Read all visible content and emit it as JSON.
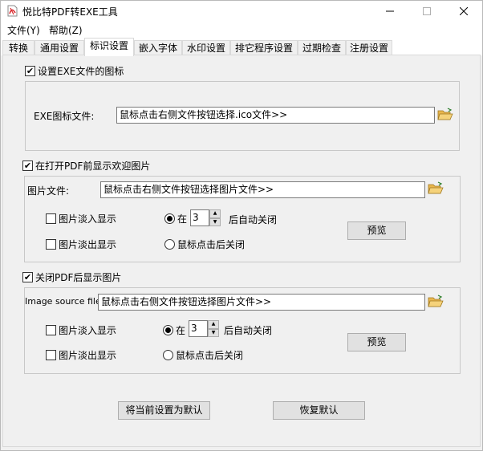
{
  "window": {
    "title": "悦比特PDF转EXE工具"
  },
  "menu": {
    "file": "文件(Y)",
    "help": "帮助(Z)"
  },
  "tabs": [
    {
      "label": "转换"
    },
    {
      "label": "通用设置"
    },
    {
      "label": "标识设置"
    },
    {
      "label": "嵌入字体"
    },
    {
      "label": "水印设置"
    },
    {
      "label": "排它程序设置"
    },
    {
      "label": "过期检查"
    },
    {
      "label": "注册设置"
    }
  ],
  "section_icon": {
    "checkbox_label": "设置EXE文件的图标",
    "checked": true,
    "field_label": "EXE图标文件:",
    "field_value": "鼠标点击右侧文件按钮选择.ico文件>>"
  },
  "section_welcome": {
    "checkbox_label": "在打开PDF前显示欢迎图片",
    "checked": true,
    "field_label": "图片文件:",
    "field_value": "鼠标点击右侧文件按钮选择图片文件>>",
    "fade_in_label": "图片淡入显示",
    "fade_in_checked": false,
    "fade_out_label": "图片淡出显示",
    "fade_out_checked": false,
    "radio_auto_prefix": "在",
    "auto_seconds": "3",
    "radio_auto_suffix": "后自动关闭",
    "radio_auto_selected": true,
    "radio_click_label": "鼠标点击后关闭",
    "preview_label": "预览"
  },
  "section_close": {
    "checkbox_label": "关闭PDF后显示图片",
    "checked": true,
    "field_label": "Image source file:",
    "field_value": "鼠标点击右侧文件按钮选择图片文件>>",
    "fade_in_label": "图片淡入显示",
    "fade_in_checked": false,
    "fade_out_label": "图片淡出显示",
    "fade_out_checked": false,
    "radio_auto_prefix": "在",
    "auto_seconds": "3",
    "radio_auto_suffix": "后自动关闭",
    "radio_auto_selected": true,
    "radio_click_label": "鼠标点击后关闭",
    "preview_label": "预览"
  },
  "footer": {
    "set_default_label": "将当前设置为默认",
    "restore_default_label": "恢复默认"
  },
  "colors": {
    "window_bg": "#f0f0f0",
    "folder_icon": "#e8b64c",
    "app_icon_red": "#d9262b"
  }
}
